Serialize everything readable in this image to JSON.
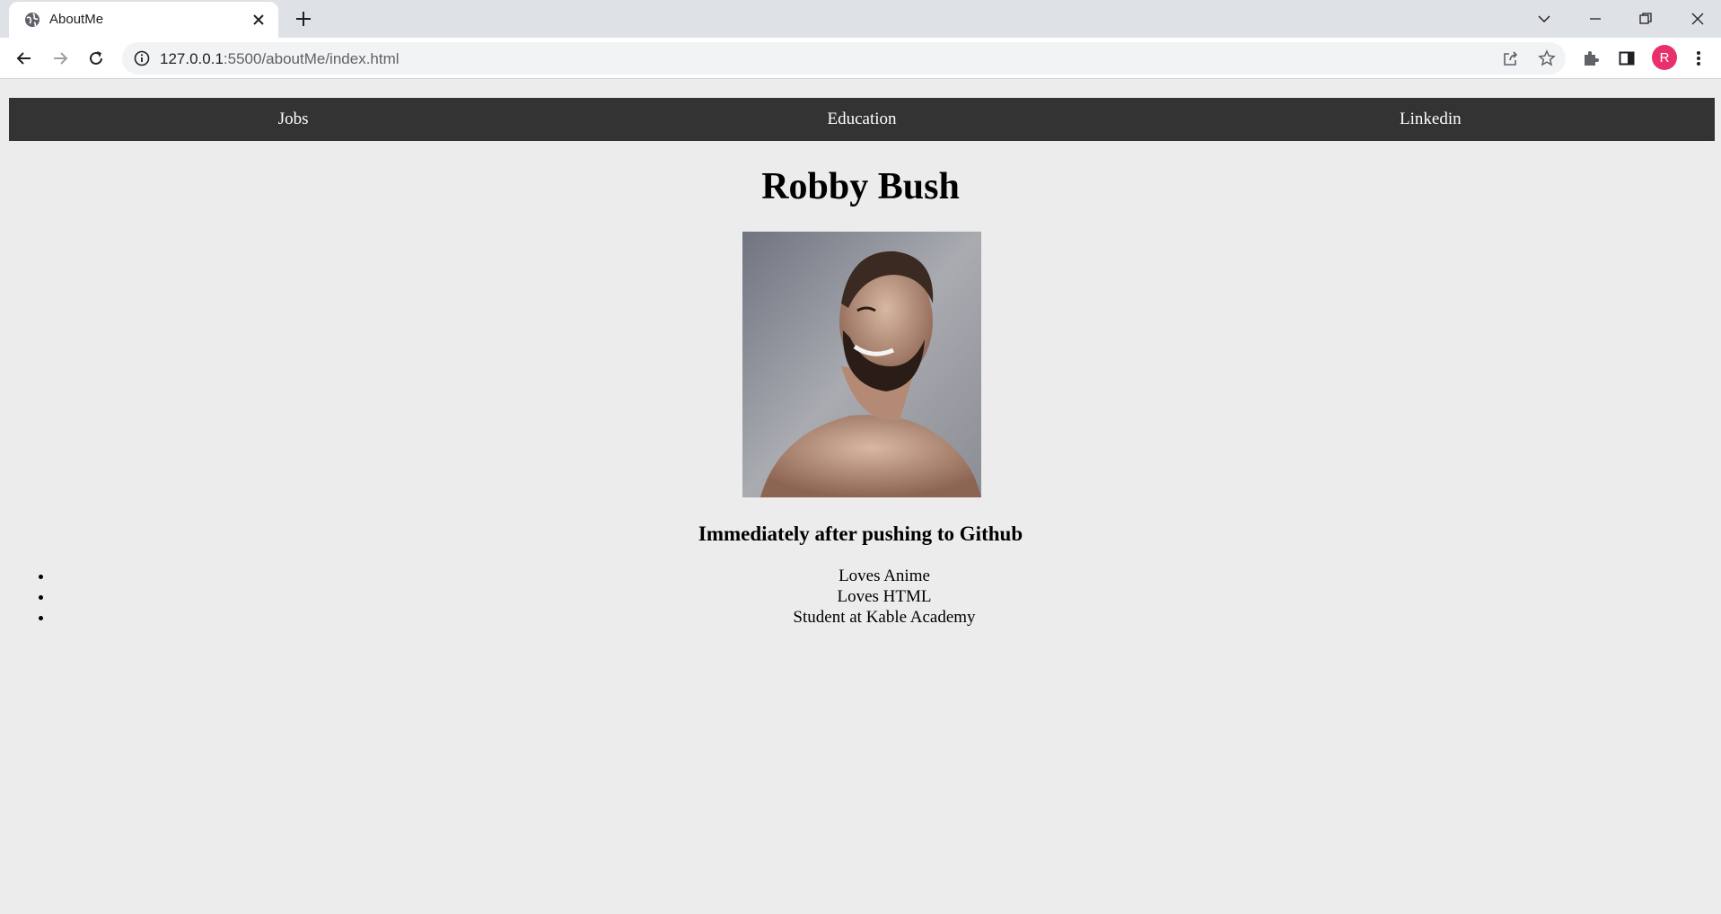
{
  "browser": {
    "tab_title": "AboutMe",
    "url_host": "127.0.0.1",
    "url_path": ":5500/aboutMe/index.html",
    "profile_initial": "R"
  },
  "nav": {
    "items": [
      {
        "label": "Jobs"
      },
      {
        "label": "Education"
      },
      {
        "label": "Linkedin"
      }
    ]
  },
  "profile": {
    "name": "Robby Bush",
    "photo_caption": "Immediately after pushing to Github",
    "facts": [
      "Loves Anime",
      "Loves HTML",
      "Student at Kable Academy"
    ]
  },
  "colors": {
    "page_bg": "#ececec",
    "nav_bg": "#333333",
    "avatar_bg": "#e8306c"
  }
}
